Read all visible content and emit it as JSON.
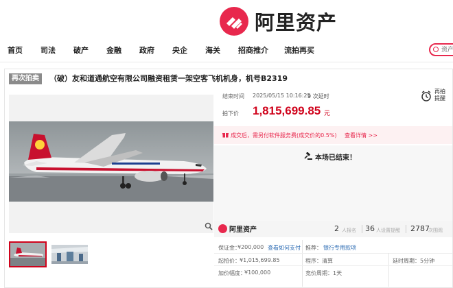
{
  "header": {
    "logo_text": "阿里资产",
    "logo_icon": "ali-asset-logo-icon"
  },
  "nav": {
    "items": [
      {
        "label": "首页"
      },
      {
        "label": "司法"
      },
      {
        "label": "破产"
      },
      {
        "label": "金融"
      },
      {
        "label": "政府"
      },
      {
        "label": "央企"
      },
      {
        "label": "海关"
      },
      {
        "label": "招商推介"
      },
      {
        "label": "流拍再买"
      }
    ],
    "search_placeholder": "资产"
  },
  "item": {
    "badge": "再次拍卖",
    "title": "（破）友和道通航空有限公司融资租赁一架空客飞机机身，机号B2319"
  },
  "auction": {
    "end_time_label": "结束时间",
    "end_time_value": "2025/05/15 10:16:25",
    "delay_count": "9 次延时",
    "price_label": "拍下价",
    "price": "1,815,699.85",
    "price_unit": "元",
    "remind_label": "再拍提醒",
    "notice_text": "成交后，需另付软件服务费(成交价的0.5%)",
    "notice_link": "查看详情 >>",
    "ended_text": "本场已结束！",
    "icons": {
      "remind": "alarm-clock-icon",
      "notice": "gift-icon",
      "ended": "gavel-icon",
      "zoom": "magnifier-icon"
    }
  },
  "stats": {
    "logo_text": "阿里资产",
    "signups": "2",
    "signups_label": "人报名",
    "reminders": "36",
    "reminders_label": "人设置提醒",
    "views": "2787",
    "views_label": "次围观"
  },
  "details": {
    "deposit_label": "保证金：",
    "deposit_value": "¥200,000",
    "deposit_link": "查看如何支付",
    "recommend_label": "推荐：",
    "recommend_link": "银行专用款项",
    "start_price_label": "起拍价：",
    "start_price_value": "¥1,015,699.85",
    "procedure_label": "程序：",
    "procedure_value": "清算",
    "delay_period_label": "延时周期：",
    "delay_period_value": "5分钟",
    "increment_label": "加价幅度：",
    "increment_value": "¥100,000",
    "bid_period_label": "竞价周期：",
    "bid_period_value": "1天"
  },
  "colors": {
    "brand": "#e8284d",
    "price": "#d0021b",
    "link": "#2e6db4",
    "badge": "#8b8b8b"
  }
}
